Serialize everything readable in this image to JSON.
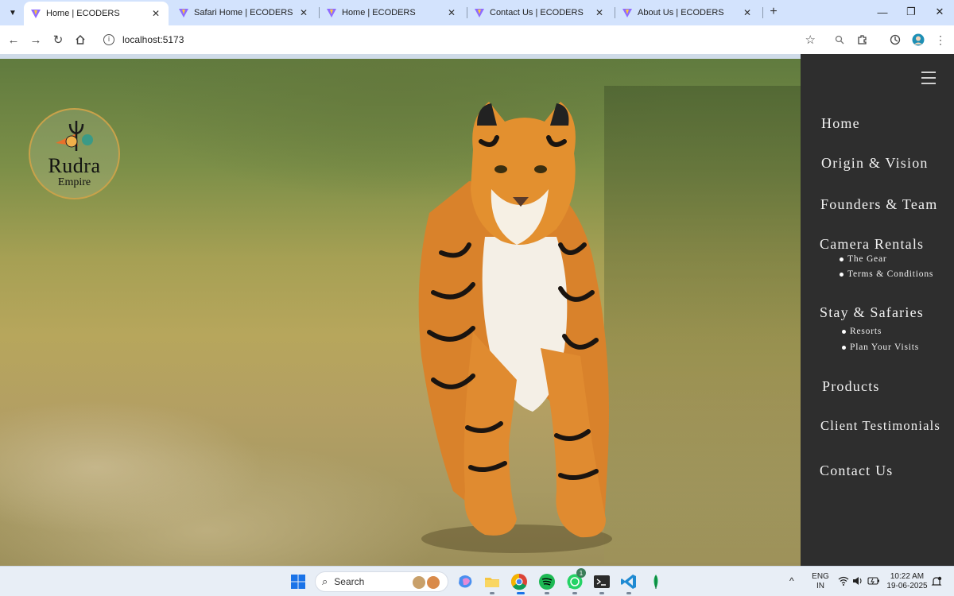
{
  "browser": {
    "tabs": [
      {
        "title": "Home | ECODERS",
        "active": true
      },
      {
        "title": "Safari Home | ECODERS",
        "active": false
      },
      {
        "title": "Home | ECODERS",
        "active": false
      },
      {
        "title": "Contact Us | ECODERS",
        "active": false
      },
      {
        "title": "About Us | ECODERS",
        "active": false
      }
    ],
    "url": "localhost:5173",
    "window_controls": {
      "minimize": "—",
      "maximize": "❐",
      "close": "✕"
    }
  },
  "logo": {
    "line1": "Rudra",
    "line2": "Empire"
  },
  "sidenav": {
    "items": [
      {
        "label": "Home"
      },
      {
        "label": "Origin & Vision"
      },
      {
        "label": "Founders & Team"
      },
      {
        "label": "Camera Rentals",
        "children": [
          "The Gear",
          "Terms & Conditions"
        ]
      },
      {
        "label": "Stay & Safaries",
        "children": [
          "Resorts",
          "Plan Your Visits"
        ]
      },
      {
        "label": "Products"
      },
      {
        "label": "Client Testimonials"
      },
      {
        "label": "Contact Us"
      }
    ]
  },
  "taskbar": {
    "search_label": "Search",
    "language": "ENG",
    "region": "IN",
    "time": "10:22 AM",
    "date": "19-06-2025",
    "whatsapp_badge": "1"
  },
  "colors": {
    "sidenav_bg": "#2e2e2e",
    "tab_strip": "#d3e3fd",
    "logo_ring": "#c9a24a"
  }
}
